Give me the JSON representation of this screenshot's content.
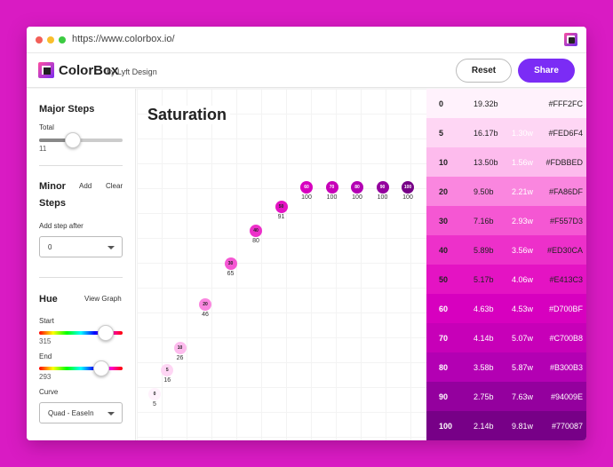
{
  "browser": {
    "url": "https://www.colorbox.io/"
  },
  "header": {
    "brand": "ColorBox",
    "by_line": "by Lyft Design",
    "reset_label": "Reset",
    "share_label": "Share"
  },
  "sidebar": {
    "major_steps": {
      "title": "Major Steps",
      "total_label": "Total",
      "total_value": "11",
      "total_fraction": 0.4
    },
    "minor_steps": {
      "title_line1": "Minor",
      "title_line2": "Steps",
      "add_label": "Add",
      "clear_label": "Clear",
      "add_after_label": "Add step after",
      "add_after_value": "0"
    },
    "hue": {
      "title": "Hue",
      "view_graph_label": "View Graph",
      "start_label": "Start",
      "start_value": "315",
      "end_label": "End",
      "end_value": "293",
      "curve_label": "Curve",
      "curve_value": "Quad - EaseIn"
    }
  },
  "graph": {
    "title": "Saturation",
    "points": [
      {
        "step": "0",
        "value": "5"
      },
      {
        "step": "5",
        "value": "16"
      },
      {
        "step": "10",
        "value": "26"
      },
      {
        "step": "20",
        "value": "46"
      },
      {
        "step": "30",
        "value": "65"
      },
      {
        "step": "40",
        "value": "80"
      },
      {
        "step": "50",
        "value": "91"
      },
      {
        "step": "60",
        "value": "100"
      },
      {
        "step": "70",
        "value": "100"
      },
      {
        "step": "80",
        "value": "100"
      },
      {
        "step": "90",
        "value": "100"
      },
      {
        "step": "100",
        "value": "100"
      }
    ]
  },
  "swatches": [
    {
      "step": "0",
      "contrast_b": "19.32b",
      "contrast_w": "",
      "hex": "#FFF2FC",
      "bg": "#FFF2FC",
      "fg": "#222222"
    },
    {
      "step": "5",
      "contrast_b": "16.17b",
      "contrast_w": "1.30w",
      "hex": "#FED6F4",
      "bg": "#FED6F4",
      "fg": "#222222"
    },
    {
      "step": "10",
      "contrast_b": "13.50b",
      "contrast_w": "1.56w",
      "hex": "#FDBBED",
      "bg": "#FDBBED",
      "fg": "#222222"
    },
    {
      "step": "20",
      "contrast_b": "9.50b",
      "contrast_w": "2.21w",
      "hex": "#FA86DF",
      "bg": "#FA86DF",
      "fg": "#222222"
    },
    {
      "step": "30",
      "contrast_b": "7.16b",
      "contrast_w": "2.93w",
      "hex": "#F557D3",
      "bg": "#F557D3",
      "fg": "#222222"
    },
    {
      "step": "40",
      "contrast_b": "5.89b",
      "contrast_w": "3.56w",
      "hex": "#ED30CA",
      "bg": "#ED30CA",
      "fg": "#222222"
    },
    {
      "step": "50",
      "contrast_b": "5.17b",
      "contrast_w": "4.06w",
      "hex": "#E413C3",
      "bg": "#E413C3",
      "fg": "#222222"
    },
    {
      "step": "60",
      "contrast_b": "4.63b",
      "contrast_w": "4.53w",
      "hex": "#D700BF",
      "bg": "#D700BF",
      "fg": "#FFFFFF"
    },
    {
      "step": "70",
      "contrast_b": "4.14b",
      "contrast_w": "5.07w",
      "hex": "#C700B8",
      "bg": "#C700B8",
      "fg": "#FFFFFF"
    },
    {
      "step": "80",
      "contrast_b": "3.58b",
      "contrast_w": "5.87w",
      "hex": "#B300B3",
      "bg": "#B300B3",
      "fg": "#FFFFFF"
    },
    {
      "step": "90",
      "contrast_b": "2.75b",
      "contrast_w": "7.63w",
      "hex": "#94009E",
      "bg": "#94009E",
      "fg": "#FFFFFF"
    },
    {
      "step": "100",
      "contrast_b": "2.14b",
      "contrast_w": "9.81w",
      "hex": "#770087",
      "bg": "#770087",
      "fg": "#FFFFFF"
    }
  ]
}
